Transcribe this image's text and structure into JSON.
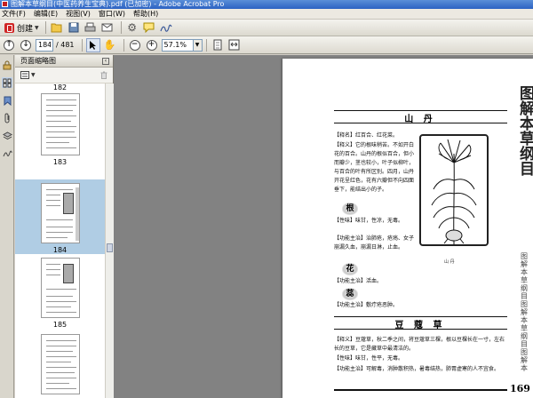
{
  "window": {
    "title": "图解本草纲目(中医药养生宝典).pdf (已加密) - Adobe Acrobat Pro"
  },
  "menu": [
    "文件(F)",
    "编辑(E)",
    "视图(V)",
    "窗口(W)",
    "帮助(H)"
  ],
  "toolbar": {
    "create_label": "创建",
    "page_current": "184",
    "page_total": "/ 481",
    "zoom_value": "57.1%"
  },
  "icons": {
    "open": "folder-open-icon",
    "save": "save-icon",
    "print": "print-icon",
    "email": "email-icon",
    "settings": "gear-icon",
    "comment": "comment-icon",
    "signature": "signature-icon",
    "prev_page": "arrow-up-icon",
    "next_page": "arrow-down-icon",
    "select": "select-arrow-icon",
    "hand": "hand-icon",
    "zoom_out": "zoom-out-icon",
    "zoom_in": "zoom-in-icon",
    "fit_page": "fit-page-icon",
    "fit_width": "fit-width-icon"
  },
  "panel": {
    "title": "页面缩略图",
    "thumbnails": [
      {
        "label": "182"
      },
      {
        "label": "183"
      },
      {
        "label": "184",
        "selected": true
      },
      {
        "label": "185"
      }
    ]
  },
  "page": {
    "vertical_title": "图解本草纲目",
    "section1_title": "山 丹",
    "section1_para1": "【释名】红百合、红花菜。",
    "section1_para2": "【释义】它的根味稍苦。不如开白花的百合。山丹的根似百合，但小而瓣少，茎也较小，叶子似柳叶，与百合的叶有所区别。四月，山丹开花呈红色，花有六瓣但不向四面垂下，能结出小的子。",
    "sub1": "根",
    "section1_para3": "【性味】味甘，性凉，无毒。",
    "section1_para4": "【功能主治】治肺疮，疮疡、女子崩漏久血，崩漏日淋，止血。",
    "sub2": "花",
    "section1_para5": "【功能主治】活血。",
    "sub3": "蕊",
    "section1_para6": "【功能主治】敷疔疮恶肿。",
    "illustration_caption": "山 丹",
    "section2_title": "豆 蔻 草",
    "section2_para1": "【释义】豆蔻草，秋二季之间，将豆蔻草三棵，根以豆棵长在一寸，左右长的豆草，它是藏草中最清洁的。",
    "section2_para2": "【性味】味甘，性平，无毒。",
    "section2_para3": "【功能主治】可解毒，消肿散积热，暑毒结热，肺胃虚寒的人不宜食。",
    "side_band": [
      "图",
      "解",
      "本",
      "草",
      "纲",
      "目",
      "图",
      "解",
      "本",
      "草",
      "纲",
      "目",
      "图",
      "解",
      "本"
    ],
    "page_number": "169"
  }
}
